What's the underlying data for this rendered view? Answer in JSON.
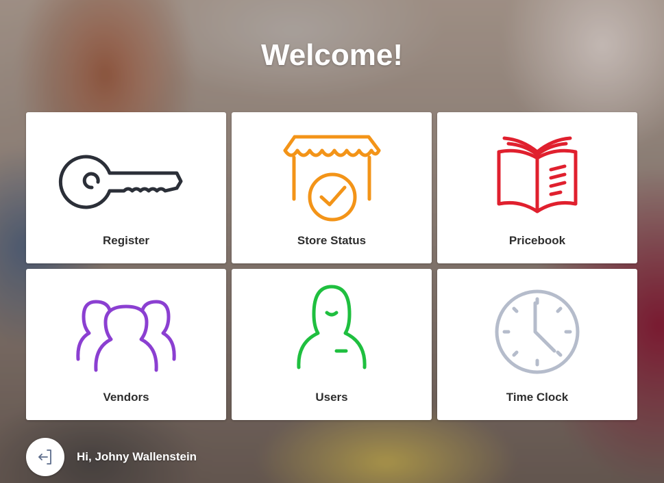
{
  "header": {
    "title": "Welcome!"
  },
  "tiles": [
    {
      "label": "Register",
      "icon": "key-icon",
      "color": "#2b2f38"
    },
    {
      "label": "Store Status",
      "icon": "storefront-check-icon",
      "color": "#f39418"
    },
    {
      "label": "Pricebook",
      "icon": "open-book-icon",
      "color": "#e0202e"
    },
    {
      "label": "Vendors",
      "icon": "people-group-icon",
      "color": "#8b3fd1"
    },
    {
      "label": "Users",
      "icon": "user-icon",
      "color": "#1fbf3f"
    },
    {
      "label": "Time Clock",
      "icon": "clock-icon",
      "color": "#b5bccb"
    }
  ],
  "footer": {
    "logout_icon": "logout-icon",
    "greeting": "Hi, Johny Wallenstein"
  }
}
